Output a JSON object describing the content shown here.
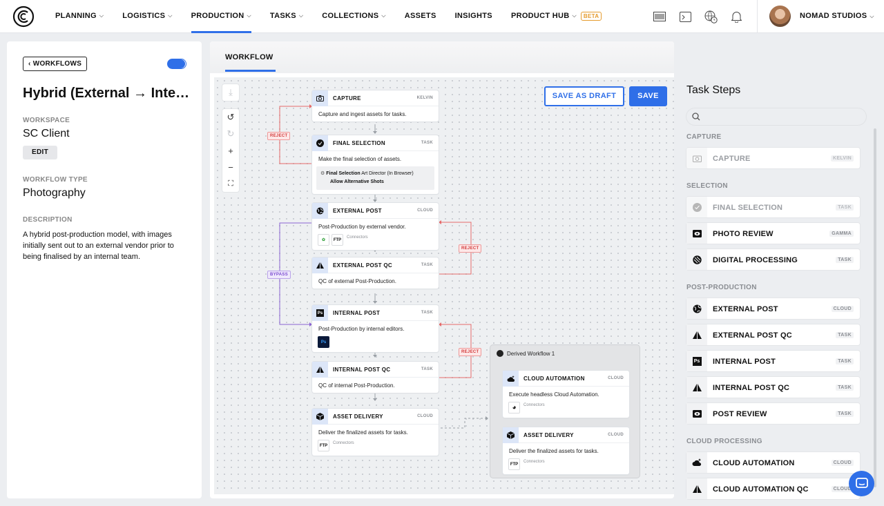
{
  "nav": {
    "items": [
      {
        "label": "PLANNING",
        "dropdown": true
      },
      {
        "label": "LOGISTICS",
        "dropdown": true
      },
      {
        "label": "PRODUCTION",
        "dropdown": true,
        "active": true
      },
      {
        "label": "TASKS",
        "dropdown": true
      },
      {
        "label": "COLLECTIONS",
        "dropdown": true
      },
      {
        "label": "ASSETS",
        "dropdown": false
      },
      {
        "label": "INSIGHTS",
        "dropdown": false
      },
      {
        "label": "PRODUCT HUB",
        "dropdown": true,
        "badge": "BETA"
      }
    ],
    "icons": [
      "barcode-icon",
      "inbox-icon",
      "globe-clock-icon",
      "bell-icon"
    ],
    "org_name": "NOMAD STUDIOS",
    "accent_color": "#2f6fe8"
  },
  "left": {
    "back_label": "WORKFLOWS",
    "toggle_on": true,
    "title": "Hybrid (External → Internal)",
    "workspace_label": "WORKSPACE",
    "workspace_value": "SC Client",
    "edit_label": "EDIT",
    "type_label": "WORKFLOW TYPE",
    "type_value": "Photography",
    "description_label": "DESCRIPTION",
    "description": "A hybrid post-production model, with images initially sent out to an external vendor prior to being finalised by an internal team."
  },
  "center": {
    "tab": "WORKFLOW",
    "save_draft": "SAVE AS DRAFT",
    "save": "SAVE",
    "badges": {
      "reject": "REJECT",
      "bypass": "BYPASS"
    },
    "nodes": {
      "capture": {
        "name": "CAPTURE",
        "tag": "KELVIN",
        "desc": "Capture and ingest assets for tasks."
      },
      "final_selection": {
        "name": "FINAL SELECTION",
        "tag": "TASK",
        "desc": "Make the final selection of assets.",
        "sub_title": "Final Selection",
        "sub_role": "Art Director (In Browser)",
        "sub_option": "Allow Alternative Shots"
      },
      "external_post": {
        "name": "EXTERNAL POST",
        "tag": "CLOUD",
        "desc": "Post-Production by external vendor.",
        "connectors": "Connectors"
      },
      "external_post_qc": {
        "name": "EXTERNAL POST QC",
        "tag": "TASK",
        "desc": "QC of external Post-Production."
      },
      "internal_post": {
        "name": "INTERNAL POST",
        "tag": "TASK",
        "desc": "Post-Production by internal editors."
      },
      "internal_post_qc": {
        "name": "INTERNAL POST QC",
        "tag": "TASK",
        "desc": "QC of internal Post-Production."
      },
      "asset_delivery": {
        "name": "ASSET DELIVERY",
        "tag": "CLOUD",
        "desc": "Deliver the finalized assets for tasks.",
        "connectors": "Connectors"
      },
      "derived_title": "Derived Workflow 1",
      "cloud_automation": {
        "name": "CLOUD AUTOMATION",
        "tag": "CLOUD",
        "desc": "Execute headless Cloud Automation.",
        "connectors": "Connectors"
      },
      "derived_delivery": {
        "name": "ASSET DELIVERY",
        "tag": "CLOUD",
        "desc": "Deliver the finalized assets for tasks.",
        "connectors": "Connectors"
      }
    }
  },
  "right": {
    "title": "Task Steps",
    "sections": {
      "capture": "CAPTURE",
      "selection": "SELECTION",
      "post": "POST-PRODUCTION",
      "cloud": "CLOUD PROCESSING"
    },
    "steps": [
      {
        "name": "CAPTURE",
        "tag": "KELVIN"
      },
      {
        "name": "FINAL SELECTION",
        "tag": "TASK"
      },
      {
        "name": "PHOTO REVIEW",
        "tag": "GAMMA"
      },
      {
        "name": "DIGITAL PROCESSING",
        "tag": "TASK"
      },
      {
        "name": "EXTERNAL POST",
        "tag": "CLOUD"
      },
      {
        "name": "EXTERNAL POST QC",
        "tag": "TASK"
      },
      {
        "name": "INTERNAL POST",
        "tag": "TASK"
      },
      {
        "name": "INTERNAL POST QC",
        "tag": "TASK"
      },
      {
        "name": "POST REVIEW",
        "tag": "TASK"
      },
      {
        "name": "CLOUD AUTOMATION",
        "tag": "CLOUD"
      },
      {
        "name": "CLOUD AUTOMATION QC",
        "tag": "CLOUD"
      }
    ]
  }
}
